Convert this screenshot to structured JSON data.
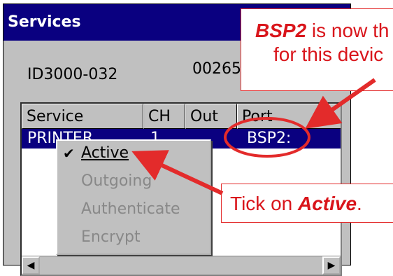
{
  "window": {
    "title": "Services",
    "device_id": "ID3000-032",
    "device_code": "00265"
  },
  "listview": {
    "columns": [
      "Service",
      "CH",
      "Out",
      "Port"
    ],
    "rows": [
      {
        "service": "PRINTER",
        "ch": "1",
        "out": "",
        "port": "BSP2:"
      }
    ]
  },
  "context_menu": {
    "items": [
      {
        "label": "Active",
        "checked": true,
        "enabled": true
      },
      {
        "label": "Outgoing",
        "checked": false,
        "enabled": false
      },
      {
        "label": "Authenticate",
        "checked": false,
        "enabled": false
      },
      {
        "label": "Encrypt",
        "checked": false,
        "enabled": false
      }
    ]
  },
  "annotations": {
    "top_callout_bold": "BSP2",
    "top_callout_rest": " is now th",
    "top_callout_line2": "for this devic",
    "bottom_callout_prefix": "Tick on ",
    "bottom_callout_bold": "Active",
    "bottom_callout_suffix": ".",
    "color": "#e32b2b"
  },
  "icons": {
    "check": "check-icon",
    "scroll_left": "scroll-left-icon",
    "scroll_right": "scroll-right-icon"
  }
}
